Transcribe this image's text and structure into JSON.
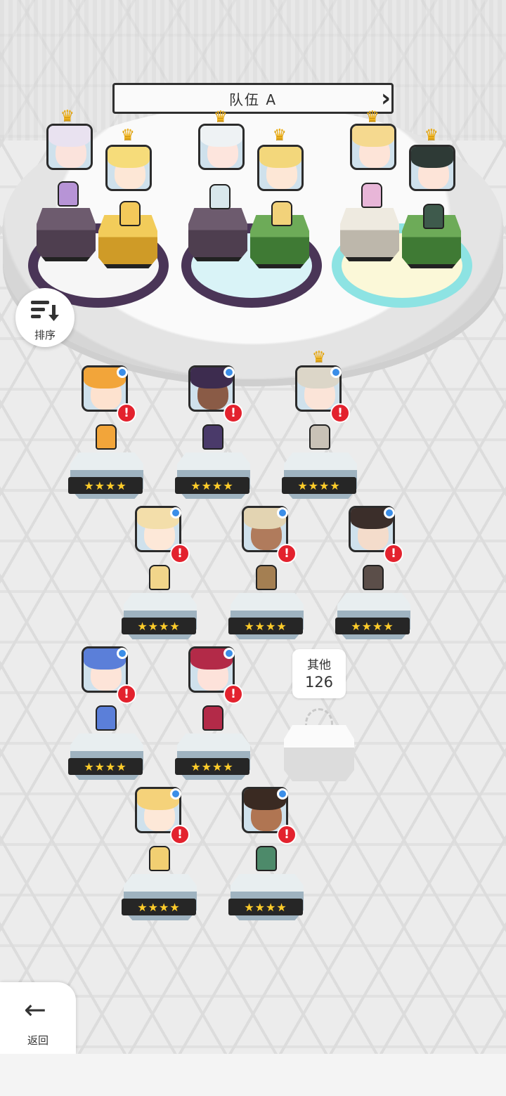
{
  "team": {
    "title": "队伍 A",
    "prev_icon": "chevron-left-icon",
    "next_icon": "chevron-right-icon"
  },
  "sort": {
    "label": "排序",
    "icon": "sort-icon"
  },
  "back": {
    "label": "返回",
    "icon": "arrow-left-icon"
  },
  "others": {
    "label": "其他",
    "count": "126"
  },
  "colors": {
    "alert": "#e3222e",
    "online_dot": "#3b8ee8",
    "star": "#ffcc2a",
    "crown": "#f2b51f"
  },
  "formation": [
    {
      "crown": true,
      "element": "dark",
      "pedestal": "purple",
      "hair": "#e9e2f0",
      "face": "#fbe3dc",
      "sprite": "#b794d6"
    },
    {
      "crown": true,
      "element": "light",
      "pedestal": "gold",
      "hair": "#f6dc7a",
      "face": "#fde7d6",
      "sprite": "#f3c95a"
    },
    {
      "crown": true,
      "element": "dark",
      "pedestal": "purple",
      "hair": "#eef2f4",
      "face": "#fde5dd",
      "sprite": "#d8e7ec"
    },
    {
      "crown": true,
      "element": "wind",
      "pedestal": "green",
      "hair": "#f3d77b",
      "face": "#fde7d6",
      "sprite": "#f2d27a"
    },
    {
      "crown": true,
      "element": "light",
      "pedestal": "stone",
      "hair": "#f5d98f",
      "face": "#fde4d8",
      "sprite": "#e8b6d8"
    },
    {
      "crown": true,
      "element": "wind",
      "pedestal": "green",
      "hair": "#2e3a36",
      "face": "#fde4d8",
      "sprite": "#3e5a4c"
    }
  ],
  "roster": [
    {
      "stars": "★★★★",
      "crown": false,
      "hair": "#f2a53a",
      "face": "#fde2cf",
      "sprite": "#f2a53a"
    },
    {
      "stars": "★★★★",
      "crown": false,
      "hair": "#3d2c4f",
      "face": "#8a5b46",
      "sprite": "#4a3a6a"
    },
    {
      "stars": "★★★★",
      "crown": true,
      "hair": "#dcd6c8",
      "face": "#fbe4d8",
      "sprite": "#c9c2b7"
    },
    {
      "stars": "★★★★",
      "crown": false,
      "hair": "#f3deaa",
      "face": "#fde8d8",
      "sprite": "#f1d58a"
    },
    {
      "stars": "★★★★",
      "crown": false,
      "hair": "#e3d4b2",
      "face": "#b07b5c",
      "sprite": "#a47f52"
    },
    {
      "stars": "★★★★",
      "crown": false,
      "hair": "#3b2e2a",
      "face": "#f4dccb",
      "sprite": "#5b4e49"
    },
    {
      "stars": "★★★★",
      "crown": false,
      "hair": "#5b7fd9",
      "face": "#fde4d8",
      "sprite": "#5b7fd9"
    },
    {
      "stars": "★★★★",
      "crown": false,
      "hair": "#b32a48",
      "face": "#fde2da",
      "sprite": "#b32a48"
    },
    {
      "stars": "★★★★",
      "crown": false,
      "hair": "#f5d27a",
      "face": "#fde8d8",
      "sprite": "#f1cf72"
    },
    {
      "stars": "★★★★",
      "crown": false,
      "hair": "#3a2a22",
      "face": "#b07552",
      "sprite": "#4d8a6a"
    }
  ]
}
